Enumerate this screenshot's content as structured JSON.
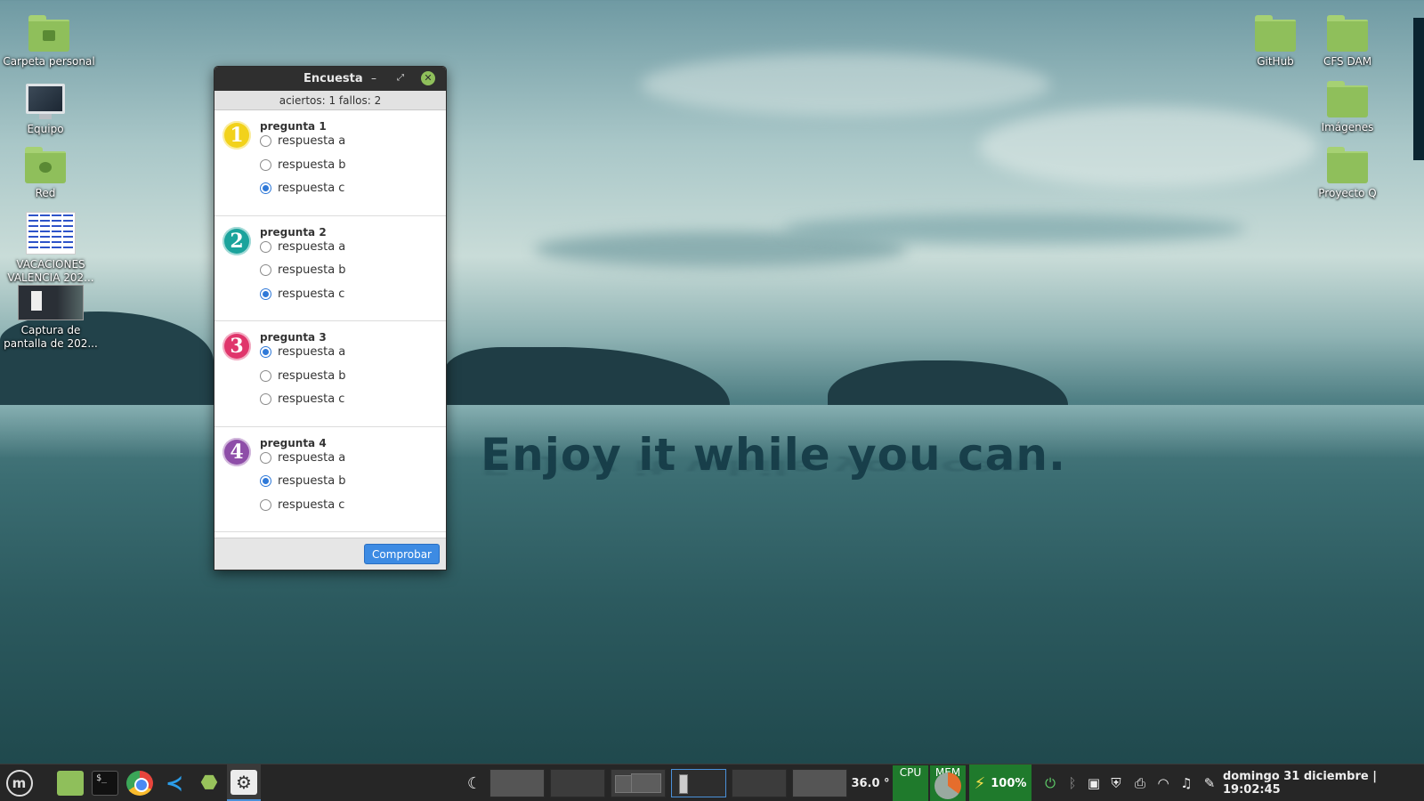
{
  "wallpaper": {
    "slogan": "Enjoy it while you can."
  },
  "desktop": {
    "left_icons": [
      {
        "label": "Carpeta personal",
        "icon": "home-folder-icon"
      },
      {
        "label": "Equipo",
        "icon": "computer-icon"
      },
      {
        "label": "Red",
        "icon": "network-folder-icon"
      },
      {
        "label": "VACACIONES VALENCIA 202...",
        "icon": "document-thumbnail-icon"
      },
      {
        "label": "Captura de pantalla de 202...",
        "icon": "screenshot-thumbnail-icon"
      }
    ],
    "right_icons": [
      {
        "label": "GitHub",
        "icon": "folder-icon"
      },
      {
        "label": "CFS DAM",
        "icon": "folder-icon"
      },
      {
        "label": "Imágenes",
        "icon": "folder-icon"
      },
      {
        "label": "Proyecto Q",
        "icon": "folder-icon"
      }
    ]
  },
  "window": {
    "title": "Encuesta",
    "score": "aciertos: 1 fallos: 2",
    "questions": [
      {
        "number": "1",
        "title": "pregunta 1",
        "color": "#f2d21b",
        "options": [
          "respuesta a",
          "respuesta b",
          "respuesta c"
        ],
        "selected": 2
      },
      {
        "number": "2",
        "title": "pregunta 2",
        "color": "#1ba39c",
        "options": [
          "respuesta a",
          "respuesta b",
          "respuesta c"
        ],
        "selected": 2
      },
      {
        "number": "3",
        "title": "pregunta 3",
        "color": "#e0356b",
        "options": [
          "respuesta a",
          "respuesta b",
          "respuesta c"
        ],
        "selected": 0
      },
      {
        "number": "4",
        "title": "pregunta 4",
        "color": "#8e4ea8",
        "options": [
          "respuesta a",
          "respuesta b",
          "respuesta c"
        ],
        "selected": 1
      }
    ],
    "check_button": "Comprobar"
  },
  "taskbar": {
    "menu_icon": "mint-logo-icon",
    "apps": [
      {
        "name": "files",
        "icon": "folder-icon"
      },
      {
        "name": "terminal",
        "icon": "terminal-icon"
      },
      {
        "name": "chrome",
        "icon": "chrome-icon"
      },
      {
        "name": "vscode",
        "icon": "vscode-icon"
      },
      {
        "name": "android-studio",
        "icon": "android-icon"
      },
      {
        "name": "settings",
        "icon": "gear-icon"
      }
    ],
    "temperature": "36.0 °",
    "cpu_label": "CPU",
    "mem_label": "MEM",
    "battery": "100%",
    "clock": "domingo 31 diciembre | 19:02:45",
    "accent": "#4a90d9"
  }
}
